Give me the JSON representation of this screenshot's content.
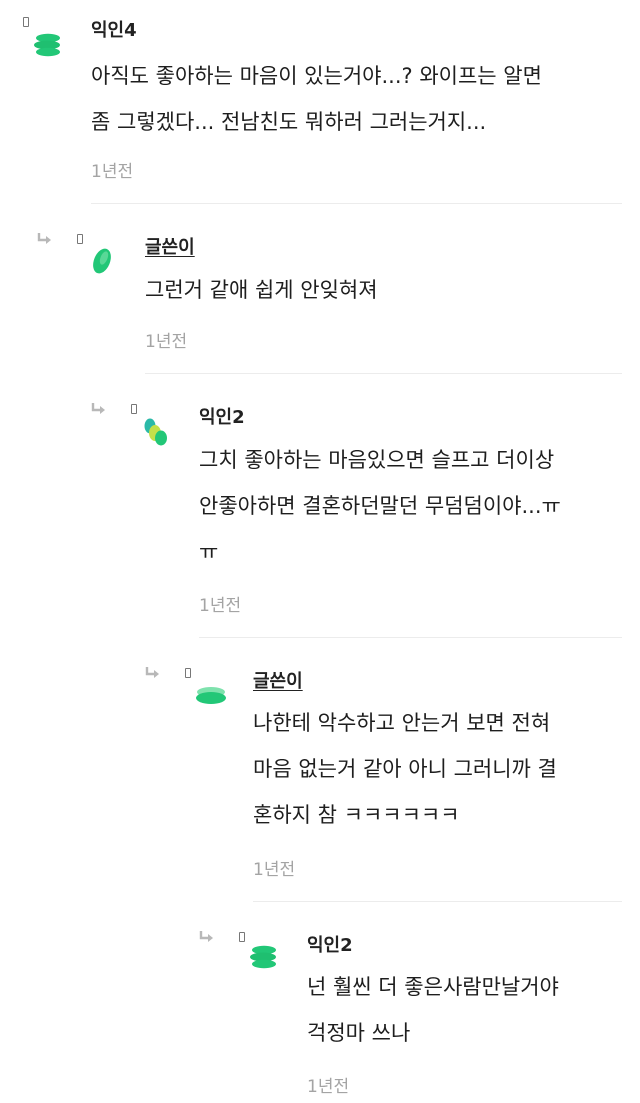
{
  "comments": [
    {
      "author": "익인4",
      "is_op": false,
      "avatar_icon": "green-stack-avatar-icon",
      "lines": [
        "아직도 좋아하는 마음이 있는거야...? 와이프는 알면",
        "좀 그렇겠다... 전남친도 뭐하러 그러는거지..."
      ],
      "time": "1년전"
    },
    {
      "author": "글쓴이",
      "is_op": true,
      "avatar_icon": "green-leaf-avatar-icon",
      "lines": [
        "그런거 같애 쉽게 안잊혀져"
      ],
      "time": "1년전"
    },
    {
      "author": "익인2",
      "is_op": false,
      "avatar_icon": "tri-color-dots-avatar-icon",
      "lines": [
        "그치 좋아하는 마음있으면 슬프고 더이상",
        "안좋아하면 결혼하던말던 무덤덤이야...ㅠ",
        "ㅠ"
      ],
      "time": "1년전"
    },
    {
      "author": "글쓴이",
      "is_op": true,
      "avatar_icon": "green-disc-avatar-icon",
      "lines": [
        "나한테 악수하고 안는거 보면 전혀",
        "마음 없는거 같아 아니 그러니까 결",
        "혼하지 참 ㅋㅋㅋㅋㅋㅋ"
      ],
      "time": "1년전"
    },
    {
      "author": "익인2",
      "is_op": false,
      "avatar_icon": "green-stack-avatar-icon",
      "lines": [
        "넌 훨씬 더 좋은사람만날거야",
        "걱정마 쓰나"
      ],
      "time": "1년전"
    }
  ],
  "colors": {
    "accent_green": "#22c777",
    "lime": "#c3e04a",
    "teal": "#2bb9a8",
    "time_gray": "#a4a4a4"
  }
}
